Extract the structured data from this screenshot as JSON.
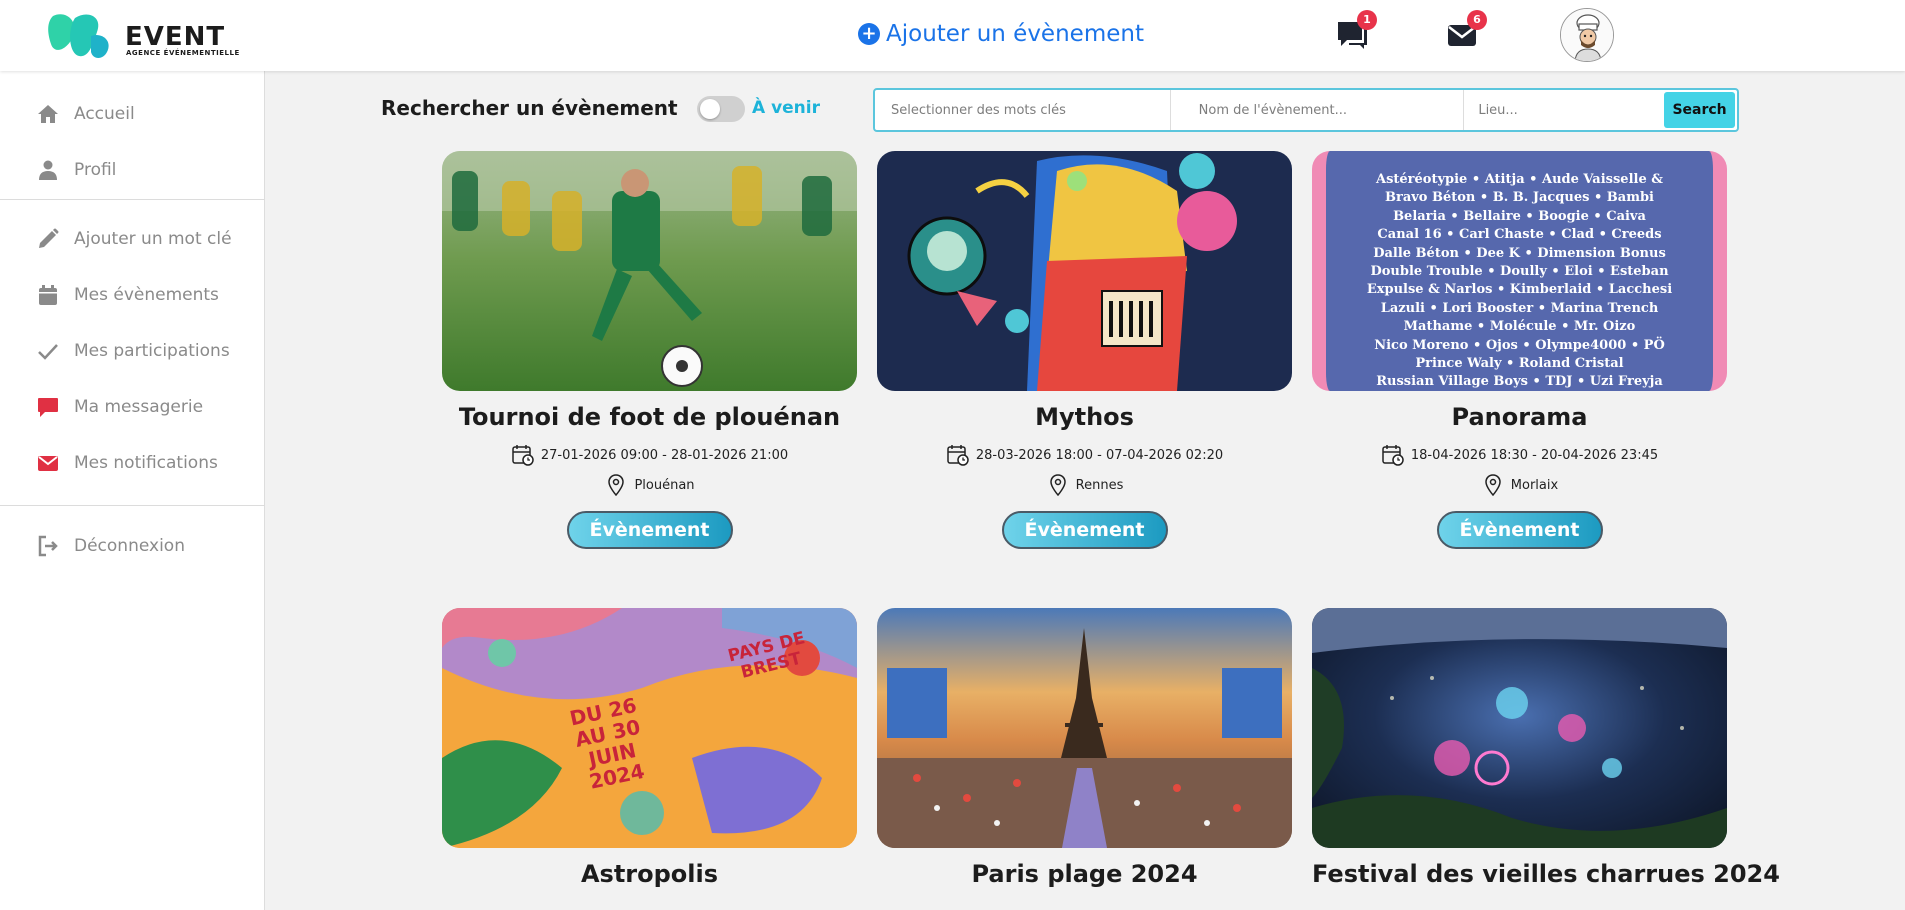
{
  "brand": {
    "name": "EVENT",
    "tagline": "AGENCE ÉVÉNEMENTIELLE"
  },
  "header": {
    "add_event_label": "Ajouter un évènement",
    "messages_badge": "1",
    "notifications_badge": "6"
  },
  "sidebar": {
    "items": [
      {
        "label": "Accueil",
        "icon": "home-icon"
      },
      {
        "label": "Profil",
        "icon": "user-icon"
      },
      {
        "label": "Ajouter un mot clé",
        "icon": "pencil-icon"
      },
      {
        "label": "Mes évènements",
        "icon": "calendar-icon"
      },
      {
        "label": "Mes participations",
        "icon": "check-icon"
      },
      {
        "label": "Ma messagerie",
        "icon": "chat-icon"
      },
      {
        "label": "Mes notifications",
        "icon": "envelope-icon"
      },
      {
        "label": "Déconnexion",
        "icon": "logout-icon"
      }
    ]
  },
  "search": {
    "title": "Rechercher un évènement",
    "toggle_label": "À venir",
    "keywords_placeholder": "Selectionner des mots clés",
    "name_placeholder": "Nom de l'évènement...",
    "place_placeholder": "Lieu...",
    "button_label": "Search"
  },
  "events": [
    {
      "title": "Tournoi de foot de plouénan",
      "dates": "27-01-2026 09:00 - 28-01-2026 21:00",
      "location": "Plouénan",
      "button": "Évènement"
    },
    {
      "title": "Mythos",
      "dates": "28-03-2026 18:00 - 07-04-2026 02:20",
      "location": "Rennes",
      "button": "Évènement"
    },
    {
      "title": "Panorama",
      "dates": "18-04-2026 18:30 - 20-04-2026 23:45",
      "location": "Morlaix",
      "button": "Évènement"
    },
    {
      "title": "Astropolis"
    },
    {
      "title": "Paris plage 2024"
    },
    {
      "title": "Festival des vieilles charrues 2024"
    }
  ],
  "poster_text": {
    "panorama_lines": [
      "Astéréotypie • Atitja • Aude Vaisselle &",
      "Bravo Béton • B. B. Jacques • Bambi",
      "Belaria • Bellaire • Boogie • Caiva",
      "Canal 16 • Carl Chaste • Clad • Creeds",
      "Dalle Béton • Dee K • Dimension Bonus",
      "Double Trouble • Doully • Eloi • Esteban",
      "Expulse & Narlos • Kimberlaid • Lacchesi",
      "Lazuli • Lori Booster • Marina Trench",
      "Mathame • Molécule • Mr. Oizo",
      "Nico Moreno • Ojos • Olympe4000 • PÖ",
      "Prince Waly • Roland Cristal",
      "Russian Village Boys • TDJ • Uzi Freyja"
    ],
    "astropolis_top": "PAYS DE BREST",
    "astropolis_dates": [
      "DU 26",
      "AU 30 JUIN",
      "2024"
    ]
  },
  "colors": {
    "accent": "#1a73e8",
    "cyan": "#1db3d9",
    "badge": "#e8334a",
    "sidebar_red": "#e03043"
  }
}
